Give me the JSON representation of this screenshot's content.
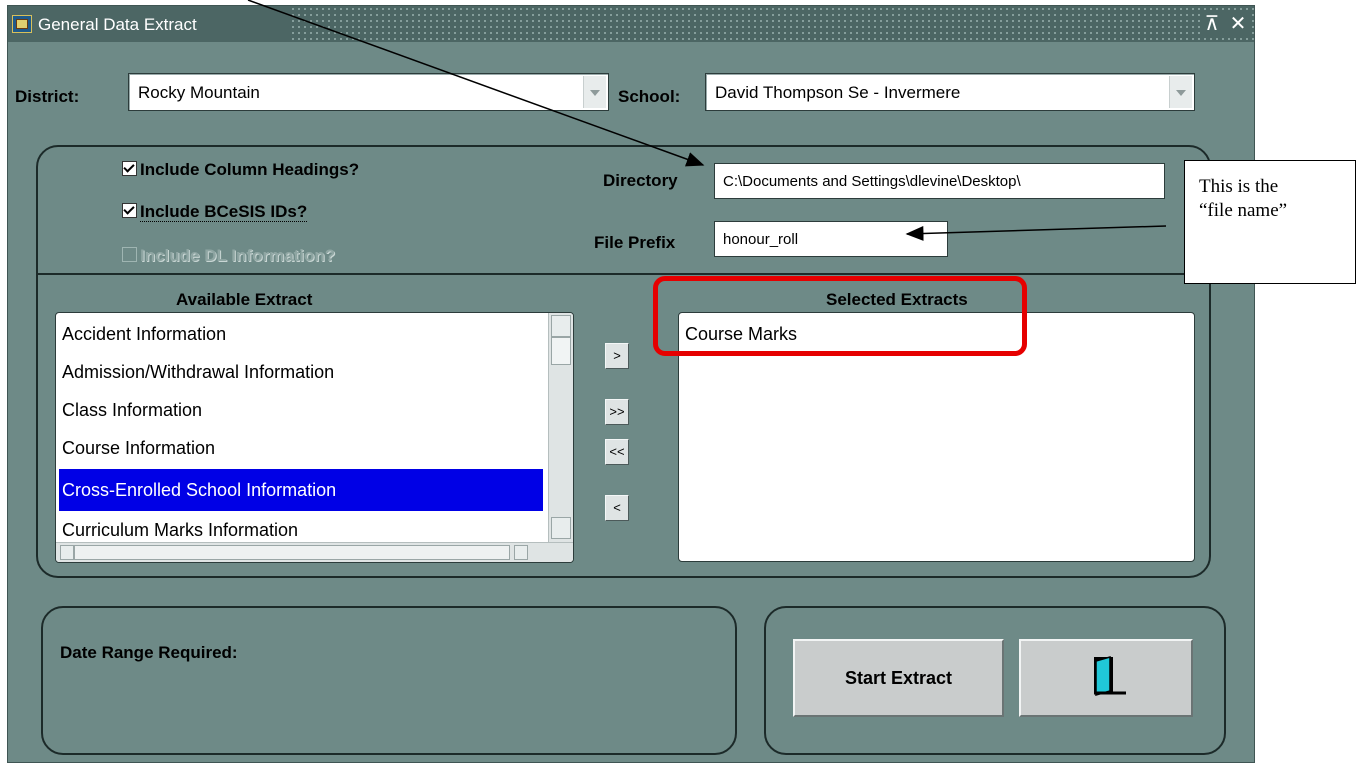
{
  "window": {
    "title": "General Data Extract"
  },
  "district": {
    "label": "District:",
    "value": "Rocky Mountain"
  },
  "school": {
    "label": "School:",
    "value": "David Thompson Se - Invermere"
  },
  "options": {
    "include_column_headings": {
      "label": "Include Column Headings?",
      "checked": true
    },
    "include_bcesis_ids": {
      "label": "Include BCeSIS IDs?",
      "checked": true
    },
    "include_dl_information": {
      "label": "Include DL Information?",
      "checked": false,
      "enabled": false
    }
  },
  "directory": {
    "label": "Directory",
    "value": "C:\\Documents and Settings\\dlevine\\Desktop\\"
  },
  "file_prefix": {
    "label": "File Prefix",
    "value": "honour_roll"
  },
  "available": {
    "header": "Available Extract",
    "items": [
      "Accident Information",
      "Admission/Withdrawal Information",
      "Class Information",
      "Course Information",
      "Cross-Enrolled School Information",
      "Curriculum Marks Information"
    ],
    "selected_item": "Cross-Enrolled School Information"
  },
  "selected": {
    "header": "Selected Extracts",
    "items": [
      "Course Marks"
    ]
  },
  "shuttle": {
    "move_one": ">",
    "move_all": ">>",
    "remove_all": "<<",
    "remove_one": "<"
  },
  "date_range": {
    "label": "Date Range Required:"
  },
  "actions": {
    "start_label": "Start Extract",
    "exit_icon": "exit-door-icon"
  },
  "annotation": {
    "callout_line1": "This is the",
    "callout_line2": "“file name”"
  },
  "colors": {
    "window_bg": "#6e8a87",
    "selection": "#0000e6",
    "highlight_box": "#e60000"
  }
}
